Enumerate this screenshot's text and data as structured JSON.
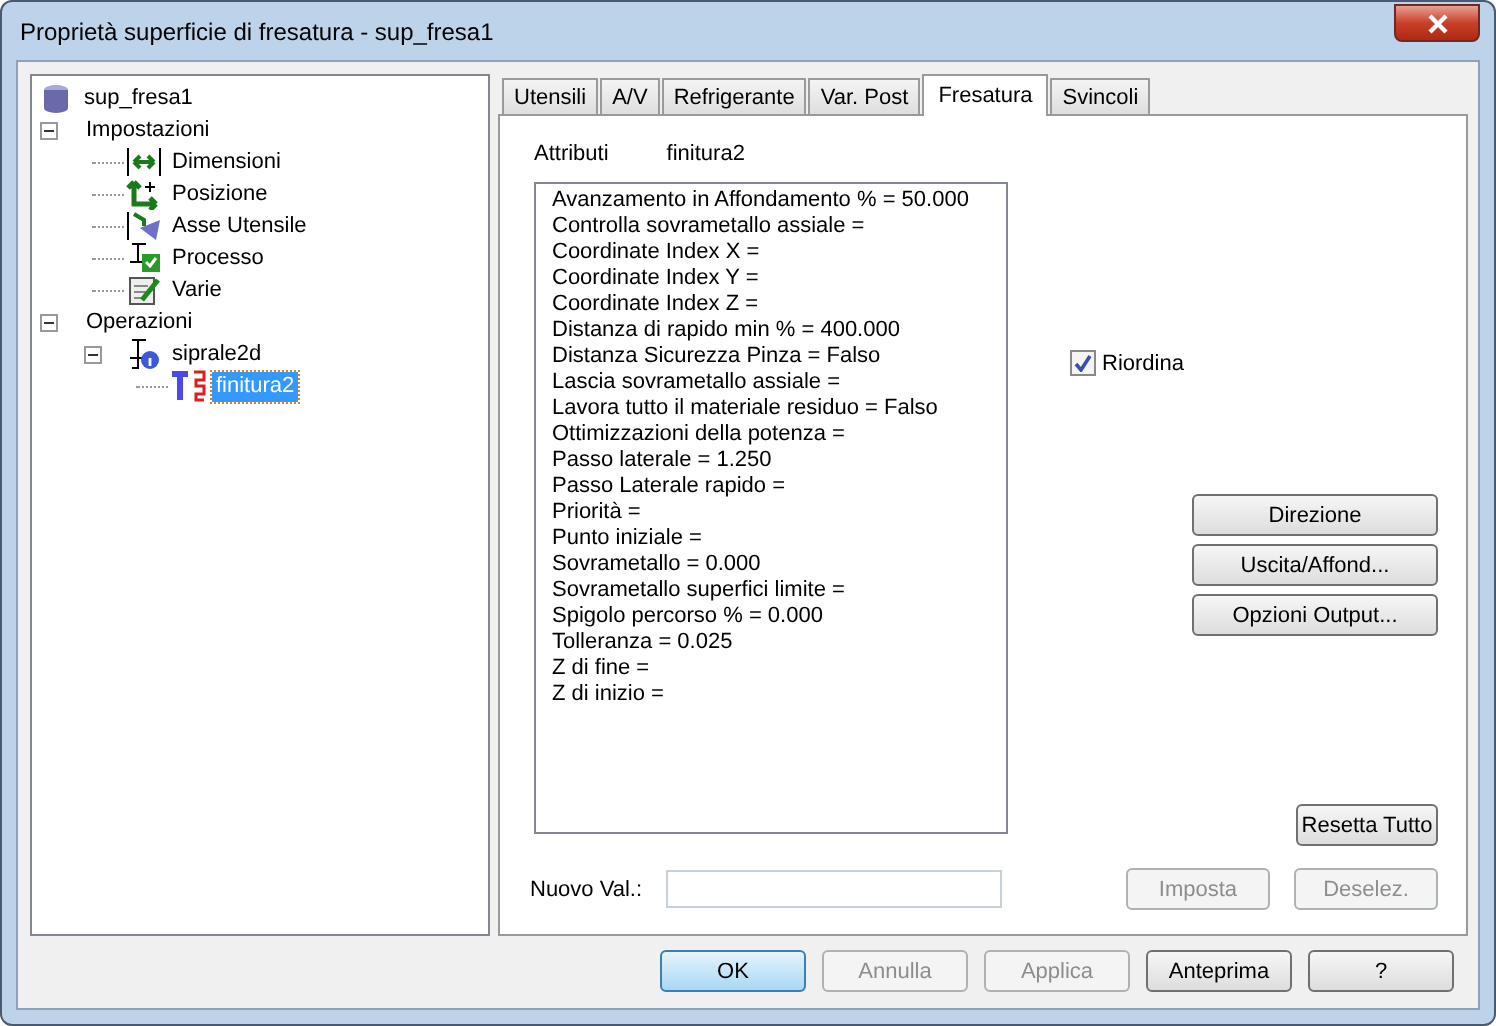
{
  "window": {
    "title": "Proprietà superficie di fresatura - sup_fresa1"
  },
  "tree": [
    {
      "label": "sup_fresa1",
      "kind": "database",
      "selected": false,
      "children": [
        {
          "label": "Impostazioni",
          "kind": "folder",
          "expanded": true,
          "selected": false,
          "children": [
            {
              "label": "Dimensioni",
              "kind": "dimensions",
              "selected": false
            },
            {
              "label": "Posizione",
              "kind": "position",
              "selected": false
            },
            {
              "label": "Asse Utensile",
              "kind": "tool-axis",
              "selected": false
            },
            {
              "label": "Processo",
              "kind": "process",
              "selected": false
            },
            {
              "label": "Varie",
              "kind": "misc",
              "selected": false
            }
          ]
        },
        {
          "label": "Operazioni",
          "kind": "folder",
          "expanded": true,
          "selected": false,
          "children": [
            {
              "label": "siprale2d",
              "kind": "operation",
              "expanded": true,
              "selected": false,
              "children": [
                {
                  "label": "finitura2",
                  "kind": "toolpath",
                  "selected": true
                }
              ]
            }
          ]
        }
      ]
    }
  ],
  "tabs": [
    {
      "label": "Utensili",
      "selected": false
    },
    {
      "label": "A/V",
      "selected": false
    },
    {
      "label": "Refrigerante",
      "selected": false
    },
    {
      "label": "Var. Post",
      "selected": false
    },
    {
      "label": "Fresatura",
      "selected": true
    },
    {
      "label": "Svincoli",
      "selected": false
    }
  ],
  "attributes": {
    "label": "Attributi",
    "value": "finitura2"
  },
  "properties": [
    "Avanzamento in Affondamento % = 50.000",
    "Controlla sovrametallo assiale =",
    "Coordinate Index X =",
    "Coordinate Index Y =",
    "Coordinate Index Z =",
    "Distanza di rapido min % = 400.000",
    "Distanza Sicurezza Pinza = Falso",
    "Lascia sovrametallo assiale =",
    "Lavora tutto il materiale residuo = Falso",
    "Ottimizzazioni della potenza =",
    "Passo laterale = 1.250",
    "Passo Laterale rapido =",
    "Priorità =",
    "Punto iniziale =",
    "Sovrametallo = 0.000",
    "Sovrametallo superfici limite =",
    "Spigolo percorso % = 0.000",
    "Tolleranza = 0.025",
    "Z di fine =",
    "Z di inizio ="
  ],
  "reorder": {
    "label": "Riordina",
    "checked": true
  },
  "side_buttons": [
    {
      "label": "Direzione",
      "disabled": false
    },
    {
      "label": "Uscita/Affond...",
      "disabled": false
    },
    {
      "label": "Opzioni Output...",
      "disabled": false
    }
  ],
  "reset_button": {
    "label": "Resetta Tutto",
    "disabled": false
  },
  "new_value": {
    "label": "Nuovo Val.:"
  },
  "value_buttons": [
    {
      "label": "Imposta",
      "disabled": true
    },
    {
      "label": "Deselez.",
      "disabled": true
    }
  ],
  "footer_buttons": [
    {
      "label": "OK",
      "disabled": false,
      "default": true
    },
    {
      "label": "Annulla",
      "disabled": true,
      "default": false
    },
    {
      "label": "Applica",
      "disabled": true,
      "default": false
    },
    {
      "label": "Anteprima",
      "disabled": false,
      "default": false
    },
    {
      "label": "?",
      "disabled": false,
      "default": false
    }
  ]
}
